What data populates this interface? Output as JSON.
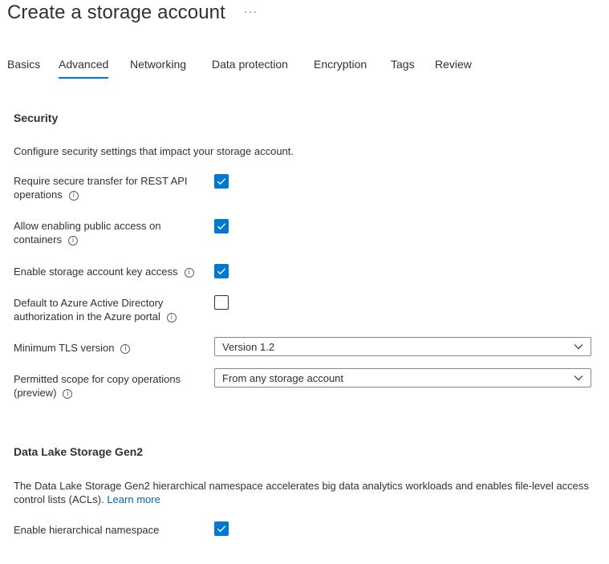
{
  "header": {
    "title": "Create a storage account",
    "more": "···"
  },
  "tabs": [
    {
      "label": "Basics",
      "active": false
    },
    {
      "label": "Advanced",
      "active": true
    },
    {
      "label": "Networking",
      "active": false
    },
    {
      "label": "Data protection",
      "active": false
    },
    {
      "label": "Encryption",
      "active": false
    },
    {
      "label": "Tags",
      "active": false
    },
    {
      "label": "Review",
      "active": false
    }
  ],
  "security": {
    "heading": "Security",
    "description": "Configure security settings that impact your storage account.",
    "settings": {
      "secure_transfer": {
        "label": "Require secure transfer for REST API operations",
        "checked": true
      },
      "public_access": {
        "label": "Allow enabling public access on containers",
        "checked": true
      },
      "key_access": {
        "label": "Enable storage account key access",
        "checked": true
      },
      "aad_default": {
        "label": "Default to Azure Active Directory authorization in the Azure portal",
        "checked": false
      }
    },
    "tls": {
      "label": "Minimum TLS version",
      "value": "Version 1.2"
    },
    "copy_scope": {
      "label": "Permitted scope for copy operations (preview)",
      "value": "From any storage account"
    }
  },
  "datalake": {
    "heading": "Data Lake Storage Gen2",
    "description": "The Data Lake Storage Gen2 hierarchical namespace accelerates big data analytics workloads and enables file-level access control lists (ACLs).",
    "learn_more": "Learn more",
    "hns": {
      "label": "Enable hierarchical namespace",
      "checked": true
    }
  },
  "icons": {
    "info": "i",
    "info_icon": "info-circle-icon",
    "check_icon": "checkmark-icon",
    "chevron_icon": "chevron-down-icon"
  },
  "colors": {
    "accent": "#0078d4",
    "link": "#0067b8",
    "text": "#323130"
  }
}
